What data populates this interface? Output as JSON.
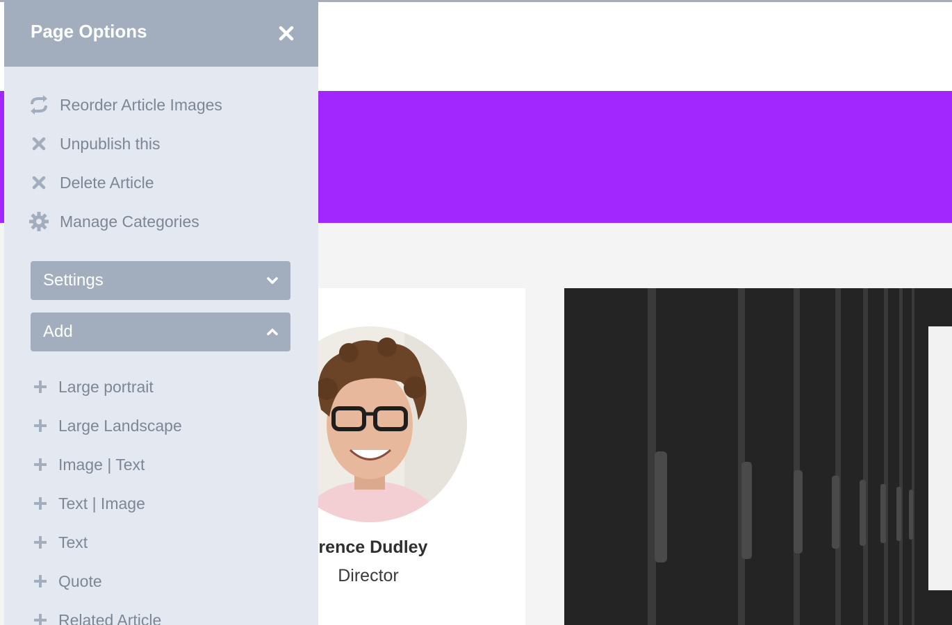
{
  "panel": {
    "title": "Page Options",
    "actions": [
      {
        "label": "Reorder Article Images",
        "icon": "refresh-icon"
      },
      {
        "label": "Unpublish this",
        "icon": "close-icon"
      },
      {
        "label": "Delete Article",
        "icon": "close-icon"
      },
      {
        "label": "Manage Categories",
        "icon": "gear-icon"
      }
    ],
    "sections": {
      "settings_label": "Settings",
      "add_label": "Add"
    },
    "add_items": [
      {
        "label": "Large portrait"
      },
      {
        "label": "Large Landscape"
      },
      {
        "label": "Image | Text"
      },
      {
        "label": "Text |  Image"
      },
      {
        "label": "Text"
      },
      {
        "label": "Quote"
      },
      {
        "label": "Related Article"
      }
    ]
  },
  "profile": {
    "name": "vrence Dudley",
    "role": "Director"
  },
  "colors": {
    "hero": "#a227ff",
    "panel_bg": "#e4e8f1",
    "panel_header": "#a2aebd",
    "panel_text": "#7c8796"
  }
}
